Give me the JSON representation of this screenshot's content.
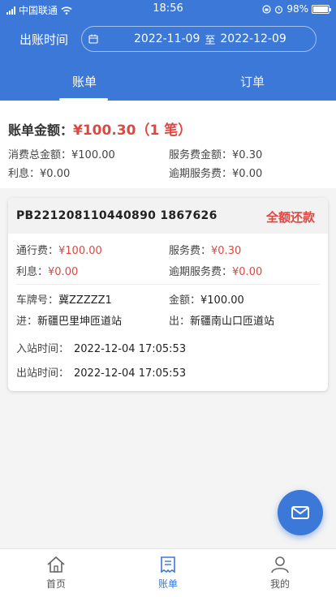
{
  "status_bar": {
    "carrier": "中国联通",
    "time": "18:56",
    "battery": "98%"
  },
  "filter": {
    "label": "出账时间",
    "start_date": "2022-11-09",
    "separator": "至",
    "end_date": "2022-12-09"
  },
  "tabs": {
    "bill": "账单",
    "order": "订单",
    "active": "bill"
  },
  "summary": {
    "title": "账单金额：",
    "amount": "¥100.30（1 笔）",
    "consumption_label": "消费总金额：",
    "consumption_value": "¥100.00",
    "service_fee_label": "服务费金额：",
    "service_fee_value": "¥0.30",
    "interest_label": "利息：",
    "interest_value": "¥0.00",
    "overdue_fee_label": "逾期服务费：",
    "overdue_fee_value": "¥0.00"
  },
  "bill_card": {
    "id": "PB221208110440890 1867626",
    "status": "全额还款",
    "toll_label": "通行费：",
    "toll_value": "¥100.00",
    "service_label": "服务费：",
    "service_value": "¥0.30",
    "interest_label": "利息：",
    "interest_value": "¥0.00",
    "overdue_label": "逾期服务费：",
    "overdue_value": "¥0.00",
    "plate_label": "车牌号：",
    "plate_value": "冀ZZZZZ1",
    "amount_label": "金额：",
    "amount_value": "¥100.00",
    "entry_label": "进：",
    "entry_value": "新疆巴里坤匝道站",
    "exit_label": "出：",
    "exit_value": "新疆南山口匝道站",
    "entry_time_label": "入站时间：",
    "entry_time_value": "2022-12-04 17:05:53",
    "exit_time_label": "出站时间：",
    "exit_time_value": "2022-12-04 17:05:53"
  },
  "bottom_nav": {
    "home": "首页",
    "bill": "账单",
    "mine": "我的"
  },
  "colors": {
    "primary": "#3b78d8",
    "accent_red": "#e0463f"
  }
}
